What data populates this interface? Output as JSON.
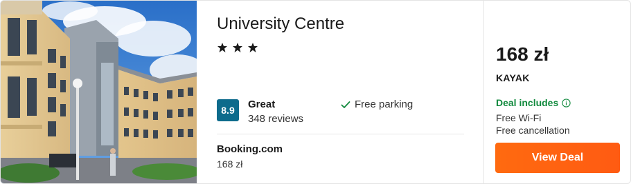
{
  "hotel": {
    "name": "University Centre",
    "star_count": 3,
    "rating_score": "8.9",
    "rating_label": "Great",
    "reviews": "348 reviews",
    "amenity": "Free parking"
  },
  "provider": {
    "name": "Booking.com",
    "price": "168 zł"
  },
  "deal": {
    "price": "168 zł",
    "source": "KAYAK",
    "includes_title": "Deal includes",
    "perks": [
      "Free Wi-Fi",
      "Free cancellation"
    ],
    "button_label": "View Deal"
  },
  "colors": {
    "score_badge": "#0d6b8c",
    "deal_includes": "#128a3e",
    "button": "#ff6a10"
  },
  "icons": {
    "stars": "star-icon",
    "amenity": "check-icon",
    "includes": "info-icon"
  }
}
